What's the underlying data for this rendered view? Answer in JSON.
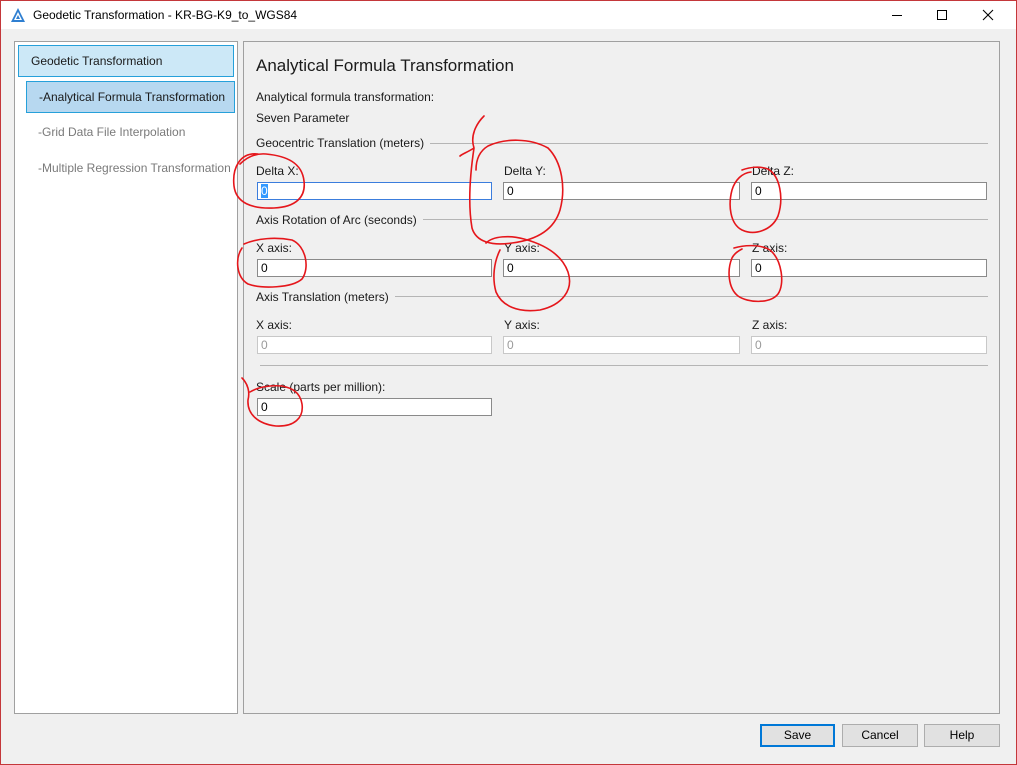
{
  "window": {
    "title": "Geodetic Transformation - KR-BG-K9_to_WGS84",
    "accent": "#0078d7"
  },
  "sidebar": {
    "root": "Geodetic Transformation",
    "items": [
      {
        "label": "-Analytical Formula Transformation",
        "selected": true
      },
      {
        "label": "-Grid Data File Interpolation",
        "selected": false
      },
      {
        "label": "-Multiple Regression Transformation",
        "selected": false
      }
    ]
  },
  "main": {
    "heading": "Analytical Formula Transformation",
    "method_label": "Analytical formula transformation:",
    "method_value": "Seven Parameter",
    "geocentric": {
      "title": "Geocentric Translation (meters)",
      "dx_label": "Delta X:",
      "dx_value": "0",
      "dy_label": "Delta Y:",
      "dy_value": "0",
      "dz_label": "Delta Z:",
      "dz_value": "0"
    },
    "rotation": {
      "title": "Axis Rotation of Arc (seconds)",
      "x_label": "X axis:",
      "x_value": "0",
      "y_label": "Y axis:",
      "y_value": "0",
      "z_label": "Z axis:",
      "z_value": "0"
    },
    "translation": {
      "title": "Axis Translation (meters)",
      "x_label": "X axis:",
      "x_value": "0",
      "y_label": "Y axis:",
      "y_value": "0",
      "z_label": "Z axis:",
      "z_value": "0"
    },
    "scale": {
      "label": "Scale (parts per million):",
      "value": "0"
    }
  },
  "buttons": {
    "save": "Save",
    "cancel": "Cancel",
    "help": "Help"
  },
  "annotation_color": "#e5161b"
}
